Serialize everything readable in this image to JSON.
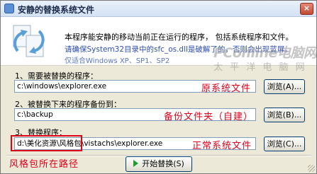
{
  "window": {
    "title": "安静的替换系统文件",
    "close_label": "×"
  },
  "header": {
    "line1": "本程序能安静的移动当前正在运行的程序， 包括系统程序和文件。",
    "line2": "请确保System32目录中的sfc_os.dll是破解了的，否则会出现蓝屏。",
    "line3": "仅适合Windows XP、SP1、SP2"
  },
  "watermark": {
    "brand": "PConline电脑网",
    "sub": "太 平 洋 电 脑 网"
  },
  "step1": {
    "label": "1、需要被替换的程序：",
    "value": "c:\\windows\\explorer.exe",
    "browse_label": "浏览(A)...",
    "annotation": "原系统文件"
  },
  "step2": {
    "label": "2、被替换下来的程序备份到：",
    "value": "c:\\backup",
    "browse_label": "浏览(B)...",
    "annotation": "备份文件夹（自建）"
  },
  "step3": {
    "label": "3、替换程序：",
    "value": "d:\\美化资源\\风格包\\vistachs\\explorer.exe",
    "browse_label": "浏览(C)...",
    "annotation": "正常系统文件",
    "box_annotation": "风格包所在路径"
  },
  "actions": {
    "start_label": "开始替换(S)"
  },
  "colors": {
    "annotation_red": "#e0001a",
    "info_blue": "#2e4fb2"
  }
}
